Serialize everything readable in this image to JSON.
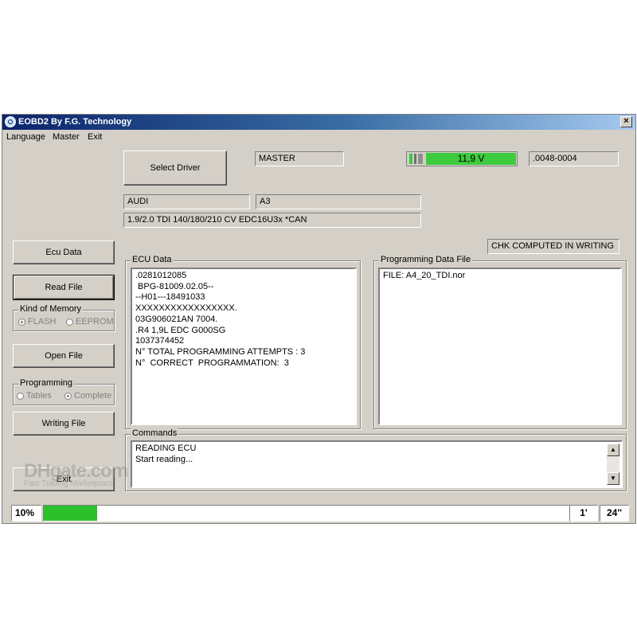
{
  "window": {
    "title": "EOBD2 By F.G. Technology",
    "close_glyph": "×"
  },
  "menu": [
    "Language",
    "Master",
    "Exit"
  ],
  "buttons": {
    "select_driver": "Select Driver",
    "ecu_data": "Ecu Data",
    "read_file": "Read File",
    "open_file": "Open File",
    "writing_file": "Writing File",
    "exit": "Exit"
  },
  "fields": {
    "master": "MASTER",
    "voltage": "11,9 V",
    "code": ".0048-0004",
    "make": "AUDI",
    "model": "A3",
    "engine": "1.9/2.0 TDI 140/180/210 CV EDC16U3x *CAN",
    "checksum": "CHK COMPUTED IN WRITING"
  },
  "kind_of_memory": {
    "label": "Kind of Memory",
    "options": [
      "FLASH",
      "EEPROM"
    ],
    "selected": "FLASH"
  },
  "programming": {
    "label": "Programming",
    "options": [
      "Tables",
      "Complete"
    ],
    "selected": "Complete"
  },
  "ecu_data": {
    "label": "ECU Data",
    "lines": [
      ".0281012085",
      " BPG-81009.02.05--",
      "--H01---18491033",
      "XXXXXXXXXXXXXXXXX.",
      "03G906021AN 7004.",
      ".R4 1,9L EDC G000SG",
      "1037374452",
      "N° TOTAL PROGRAMMING ATTEMPTS : 3",
      "N°  CORRECT  PROGRAMMATION:  3"
    ]
  },
  "programming_data_file": {
    "label": "Programming Data File",
    "lines": [
      "FILE: A4_20_TDI.nor"
    ]
  },
  "commands": {
    "label": "Commands",
    "lines": [
      "READING ECU",
      "Start reading..."
    ]
  },
  "status": {
    "progress_text": "10%",
    "progress": 0.1,
    "minutes": "1'",
    "seconds": "24''"
  },
  "watermark": {
    "brand": "DHgate.com",
    "tagline": "Fast Trading Marketplace"
  },
  "colors": {
    "voltage_green": "#3ccb3c",
    "progress_green": "#2cc02c",
    "title_blue": "#0a246a"
  }
}
